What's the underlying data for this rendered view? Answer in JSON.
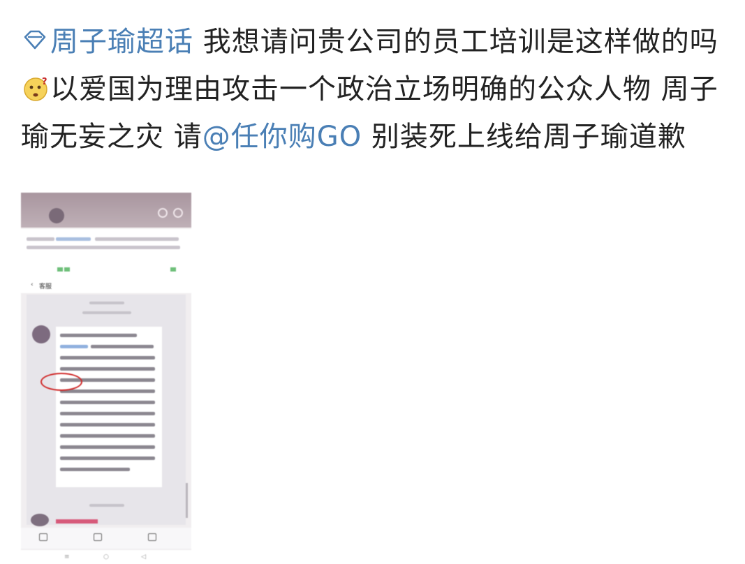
{
  "post": {
    "topic": "周子瑜超话",
    "segments": {
      "part1": "我想请问贵公司的员工培训是这样做的吗",
      "part2": "以爱国为理由攻击一个政治立场明确的公众人物 周子瑜无妄之灾 请",
      "mention": "@任你购GO",
      "part3": " 别装死上线给周子瑜道歉"
    },
    "topic_icon": "diamond-icon",
    "emoji_icon": "confused-face-emoji",
    "colors": {
      "link": "#4a7fb5",
      "text": "#222222"
    }
  },
  "embedded_screenshot": {
    "nav_label": "客服",
    "annotation_color": "#d02a2a"
  }
}
